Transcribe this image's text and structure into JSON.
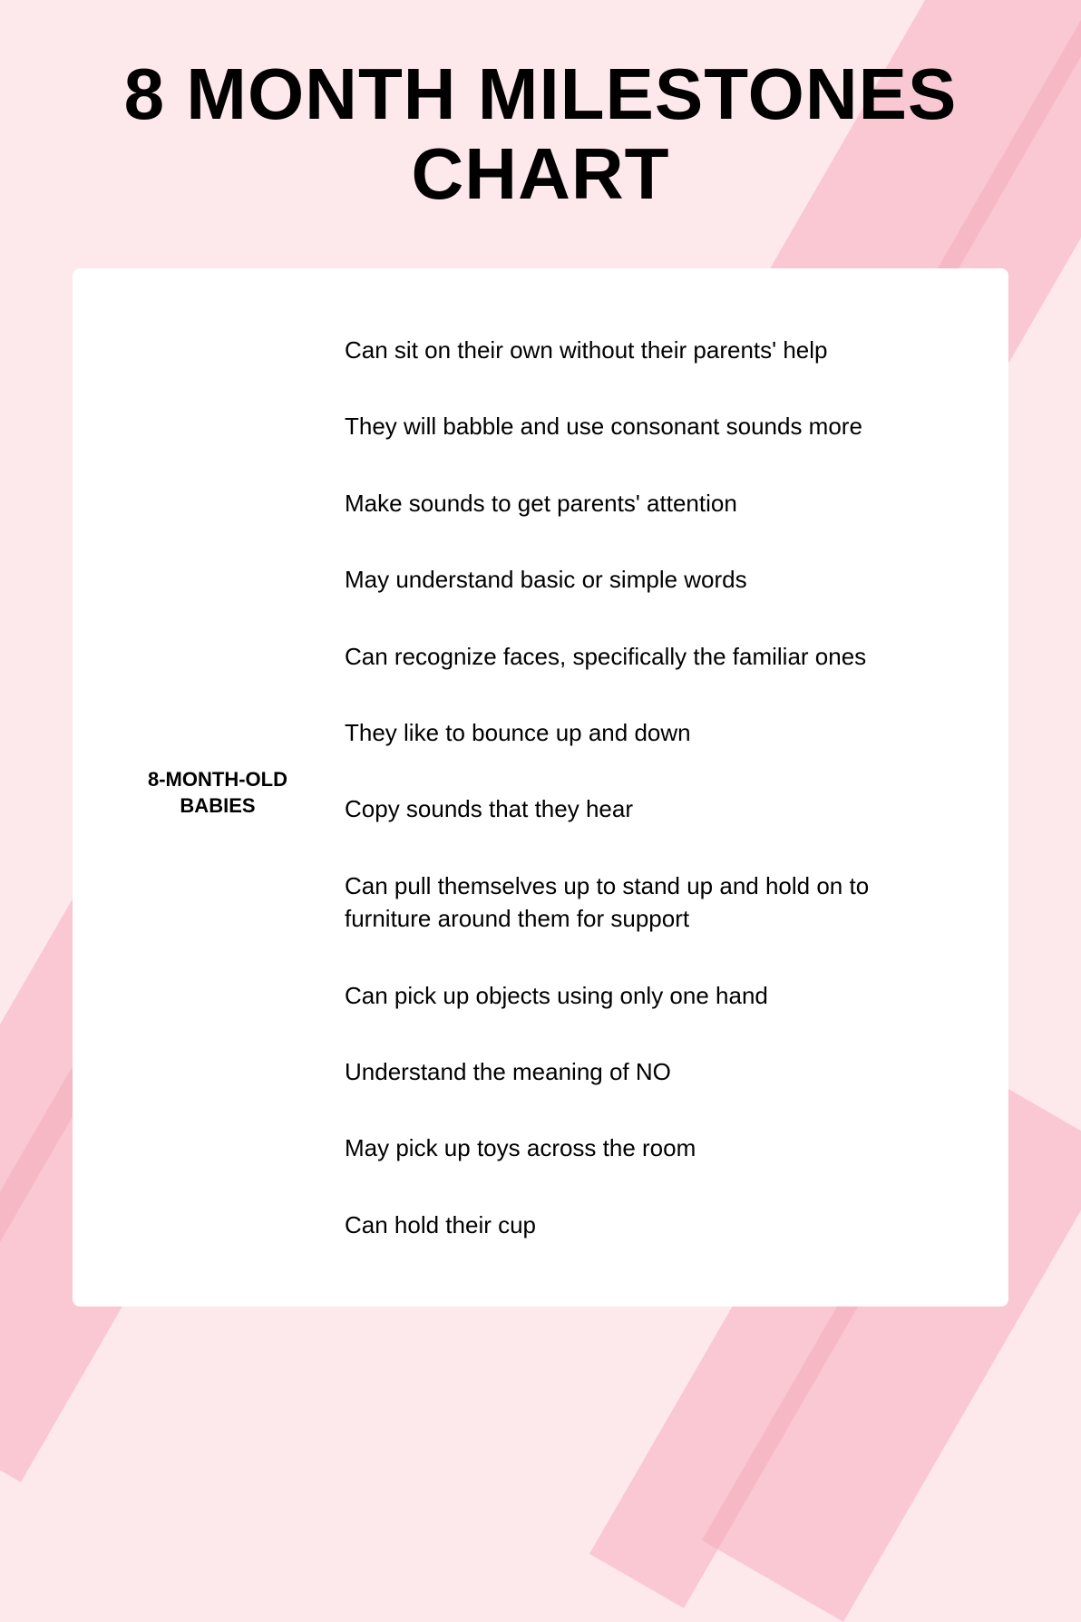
{
  "page": {
    "title_line1": "8 MONTH MILESTONES",
    "title_line2": "CHART",
    "background_color": "#fde8ec",
    "stripe_color": "#f5a8b8"
  },
  "label": {
    "line1": "8-MONTH-OLD",
    "line2": "BABIES"
  },
  "milestones": [
    {
      "id": 1,
      "text": "Can sit on their own without their parents' help"
    },
    {
      "id": 2,
      "text": "They will babble and use consonant sounds more"
    },
    {
      "id": 3,
      "text": "Make sounds to get parents' attention"
    },
    {
      "id": 4,
      "text": "May understand basic or simple words"
    },
    {
      "id": 5,
      "text": "Can recognize faces, specifically the familiar ones"
    },
    {
      "id": 6,
      "text": "They like to bounce up and down"
    },
    {
      "id": 7,
      "text": "Copy sounds that they hear"
    },
    {
      "id": 8,
      "text": "Can pull themselves up to stand up and hold on to furniture around them for support"
    },
    {
      "id": 9,
      "text": "Can pick up objects using only one hand"
    },
    {
      "id": 10,
      "text": "Understand the meaning of NO"
    },
    {
      "id": 11,
      "text": "May pick up toys across the room"
    },
    {
      "id": 12,
      "text": "Can hold their cup"
    }
  ]
}
